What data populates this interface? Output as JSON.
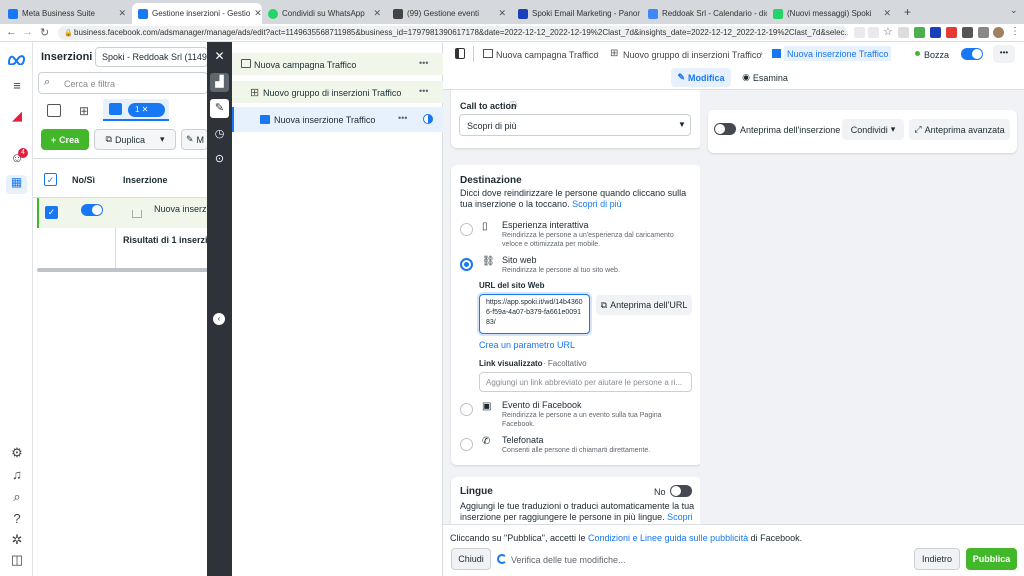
{
  "browser": {
    "tabs": [
      {
        "title": "Meta Business Suite",
        "color": "#1877f2"
      },
      {
        "title": "Gestione inserzioni - Gestio",
        "color": "#1877f2"
      },
      {
        "title": "Condividi su WhatsApp",
        "color": "#25d366"
      },
      {
        "title": "(99) Gestione eventi",
        "color": "#444444"
      },
      {
        "title": "Spoki Email Marketing - Panor",
        "color": "#1a3fb8"
      },
      {
        "title": "Reddoak Srl - Calendario - dic",
        "color": "#4285f4"
      },
      {
        "title": "(Nuovi messaggi) Spoki",
        "color": "#25d366"
      }
    ],
    "url": "business.facebook.com/adsmanager/manage/ads/edit?act=1149635568711985&business_id=1797981390617178&date=2022-12-12_2022-12-19%2Clast_7d&insights_date=2022-12-12_2022-12-19%2Clast_7d&selec..."
  },
  "sidebar": {
    "notification_count": "4"
  },
  "panel": {
    "title": "Inserzioni",
    "account": "Spoki - Reddoak Srl (114963",
    "search_placeholder": "Cerca e filtra",
    "selected_count": "1",
    "create_label": "Crea",
    "duplicate_label": "Duplica",
    "edit_label": "M",
    "col_onoff": "No/Sì",
    "col_name": "Inserzione",
    "row_name": "Nuova inserzio",
    "results": "Risultati di 1 inserzion"
  },
  "tree": {
    "campaign": "Nuova campagna Traffico",
    "adset": "Nuovo gruppo di inserzioni Traffico",
    "ad": "Nuova inserzione Traffico"
  },
  "header": {
    "breadcrumb": [
      "Nuova campagna Traffico",
      "Nuovo gruppo di inserzioni Traffico",
      "Nuova inserzione Traffico"
    ],
    "status": "Bozza",
    "tab_edit": "Modifica",
    "tab_review": "Esamina"
  },
  "cta": {
    "label": "Call to action",
    "value": "Scopri di più"
  },
  "destination": {
    "title": "Destinazione",
    "desc": "Dicci dove reindirizzare le persone quando cliccano sulla tua inserzione o la toccano.",
    "learn_more": "Scopri di più",
    "options": [
      {
        "title": "Esperienza interattiva",
        "desc": "Reindirizza le persone a un'esperienza dal caricamento veloce e ottimizzata per mobile."
      },
      {
        "title": "Sito web",
        "desc": "Reindirizza le persone al tuo sito web."
      },
      {
        "title": "Evento di Facebook",
        "desc": "Reindirizza le persone a un evento sulla tua Pagina Facebook."
      },
      {
        "title": "Telefonata",
        "desc": "Consenti alle persone di chiamarti direttamente."
      }
    ],
    "url_label": "URL del sito Web",
    "url_value": "https://app.spoki.it/wd/14b43606-f59a-4a07-b379-fa661e009183/",
    "url_preview": "Anteprima dell'URL",
    "url_param": "Crea un parametro URL",
    "display_link_label": "Link visualizzato",
    "display_link_optional": "· Facoltativo",
    "display_link_placeholder": "Aggiungi un link abbreviato per aiutare le persone a ri..."
  },
  "languages": {
    "title": "Lingue",
    "toggle": "No",
    "desc": "Aggiungi le tue traduzioni o traduci automaticamente la tua inserzione per raggiungere le persone in più lingue.",
    "learn_more": "Scopri di più"
  },
  "preview": {
    "label": "Anteprima dell'inserzione",
    "share": "Condividi",
    "advanced": "Anteprima avanzata"
  },
  "footer": {
    "text_pre": "Cliccando su \"Pubblica\", accetti le",
    "link": "Condizioni e Linee guida sulle pubblicità",
    "text_post": "di Facebook.",
    "close": "Chiudi",
    "verify": "Verifica delle tue modifiche...",
    "back": "Indietro",
    "publish": "Pubblica"
  },
  "colors": {
    "brand": "#1877f2",
    "publish": "#42b72a",
    "dark_rail": "#2d3338"
  }
}
